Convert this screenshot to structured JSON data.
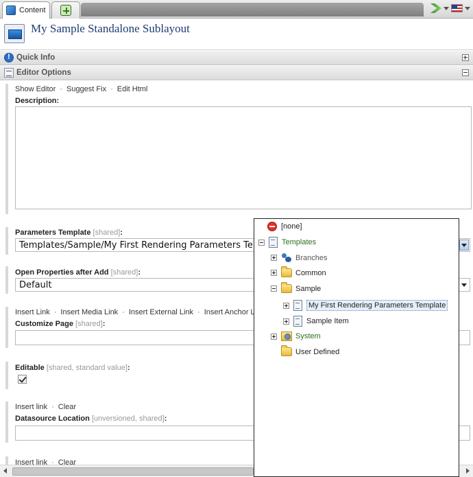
{
  "tabs": [
    {
      "label": "Content",
      "icon": "content-cube-icon"
    },
    {
      "label": "",
      "icon": "add-tab-icon"
    }
  ],
  "toolbar_icons": [
    "navigate-green-icon",
    "us-flag-icon"
  ],
  "item": {
    "title": "My Sample Standalone Sublayout",
    "icon": "sublayout-icon"
  },
  "sections": {
    "quick_info": {
      "label": "Quick Info",
      "icon": "info-icon",
      "collapsed": true
    },
    "editor_options": {
      "label": "Editor Options",
      "icon": "editor-options-icon",
      "collapsed": false
    }
  },
  "description": {
    "links": [
      "Show Editor",
      "Suggest Fix",
      "Edit Html"
    ],
    "label": "Description:",
    "value": ""
  },
  "parameters_template": {
    "label": "Parameters Template",
    "meta": "[shared]",
    "suffix": ":",
    "value": "Templates/Sample/My First Rendering Parameters Template"
  },
  "open_properties": {
    "label": "Open Properties after Add",
    "meta": "[shared]",
    "suffix": ":",
    "value": "Default"
  },
  "customize_page": {
    "links": [
      "Insert Link",
      "Insert Media Link",
      "Insert External Link",
      "Insert Anchor Link"
    ],
    "label": "Customize Page",
    "meta": "[shared]",
    "suffix": ":",
    "value": ""
  },
  "editable": {
    "label": "Editable",
    "meta": "[shared, standard value]",
    "suffix": ":",
    "checked": true
  },
  "datasource_location": {
    "links": [
      "Insert link",
      "Clear"
    ],
    "label": "Datasource Location",
    "meta": "[unversioned, shared]",
    "suffix": ":",
    "value": ""
  },
  "next_field_links": [
    "Insert link",
    "Clear"
  ],
  "tree": {
    "none_label": "[none]",
    "root_label": "Templates",
    "children": [
      {
        "label": "Branches"
      },
      {
        "label": "Common"
      },
      {
        "label": "Sample"
      },
      {
        "label": "System"
      },
      {
        "label": "User Defined"
      }
    ],
    "sample_children": [
      {
        "label": "My First Rendering Parameters Template",
        "selected": true
      },
      {
        "label": "Sample Item"
      }
    ]
  }
}
